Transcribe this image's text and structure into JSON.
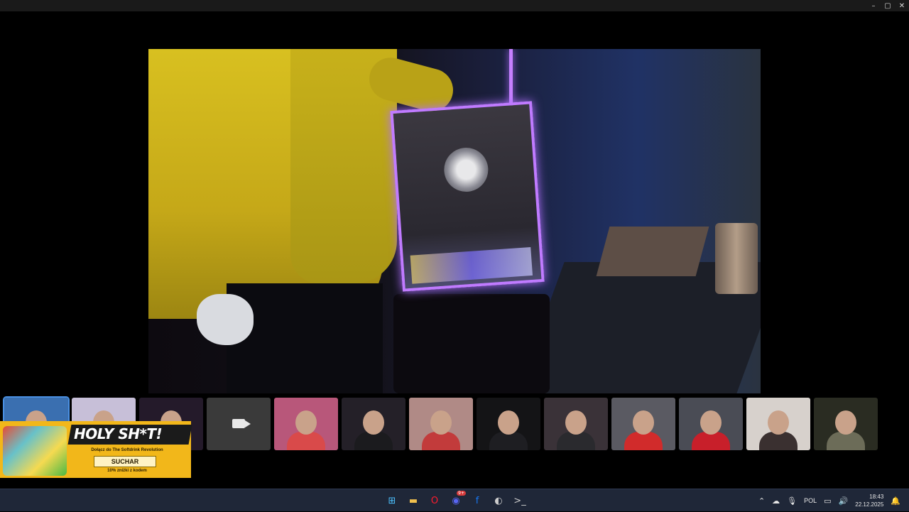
{
  "window": {
    "controls": {
      "minimize": "–",
      "maximize": "▢",
      "close": "✕"
    }
  },
  "stage": {
    "icon": "video-feed"
  },
  "participants": [
    {
      "name": "participant-1",
      "bg": "#3a6fb0",
      "body": "#2a3d63",
      "active": true
    },
    {
      "name": "participant-2",
      "bg": "#c7bfd8",
      "body": "#4a2f74"
    },
    {
      "name": "participant-3",
      "bg": "#241a2a",
      "body": "#3b2040"
    },
    {
      "name": "participant-4",
      "bg": "#3a3a3a",
      "camera_off": true,
      "icon": "camera-icon"
    },
    {
      "name": "participant-5",
      "bg": "#b8577a",
      "body": "#d94a4a"
    },
    {
      "name": "participant-6",
      "bg": "#242028",
      "body": "#1b1b1e"
    },
    {
      "name": "participant-7",
      "bg": "#b08a86",
      "body": "#c23b3b"
    },
    {
      "name": "participant-8",
      "bg": "#141416",
      "body": "#1e1e22"
    },
    {
      "name": "participant-9",
      "bg": "#3a3238",
      "body": "#2a2a2e"
    },
    {
      "name": "participant-10",
      "bg": "#5a5a62",
      "body": "#d12b2b"
    },
    {
      "name": "participant-11",
      "bg": "#4a4c55",
      "body": "#c81f2a"
    },
    {
      "name": "participant-12",
      "bg": "#d7d1cc",
      "body": "#3a3030"
    },
    {
      "name": "participant-13",
      "bg": "#2a2c22",
      "body": "#6c6c58"
    }
  ],
  "promo": {
    "title": "HOLY SH*T!",
    "subtitle": "Dołącz do The Softdrink Revolution",
    "code": "SUCHAR",
    "note": "10% zniżki z kodem"
  },
  "taskbar": {
    "apps": [
      {
        "name": "start-icon",
        "glyph": "⊞",
        "color": "#4cc2ff"
      },
      {
        "name": "file-explorer-icon",
        "glyph": "▬",
        "color": "#f2c14e"
      },
      {
        "name": "opera-icon",
        "glyph": "O",
        "color": "#ff1b2d"
      },
      {
        "name": "discord-icon",
        "glyph": "◉",
        "color": "#5865f2",
        "badge": "9+"
      },
      {
        "name": "facebook-icon",
        "glyph": "f",
        "color": "#1877f2"
      },
      {
        "name": "obs-icon",
        "glyph": "◐",
        "color": "#cccccc"
      },
      {
        "name": "terminal-icon",
        "glyph": ">_",
        "color": "#cccccc"
      }
    ],
    "tray": {
      "chevron": "⌃",
      "lang": "POL",
      "time": "18:43",
      "date": "22.12.2025"
    }
  }
}
